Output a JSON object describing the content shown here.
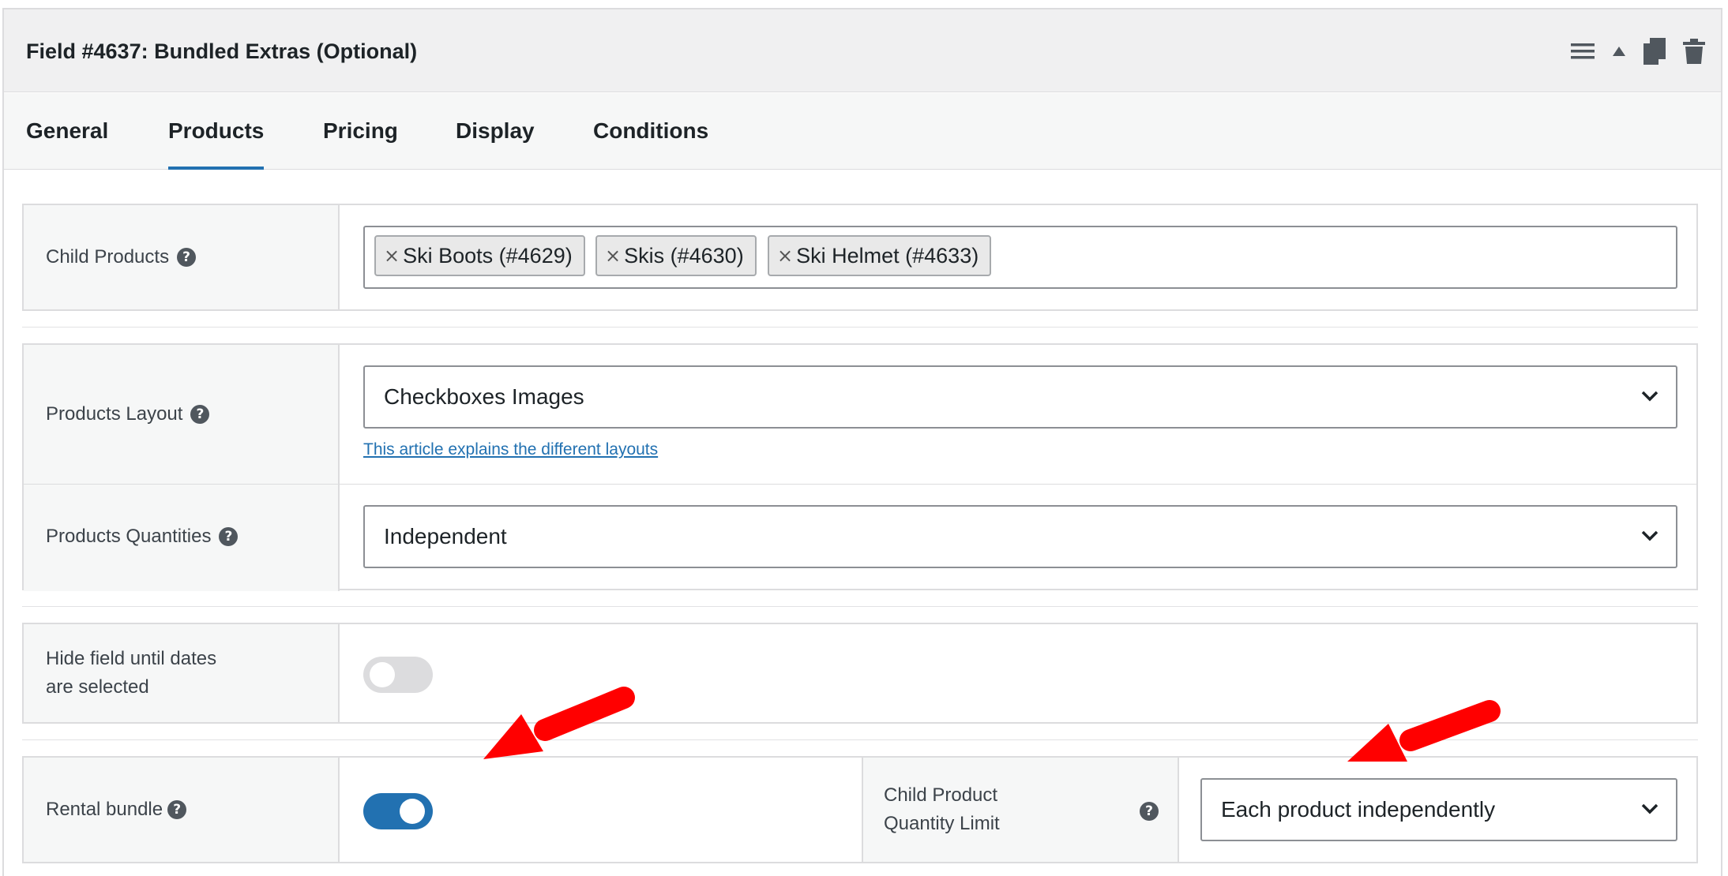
{
  "header": {
    "title": "Field #4637: Bundled Extras (Optional)",
    "icons": [
      "menu-icon",
      "collapse-arrow-icon",
      "duplicate-icon",
      "trash-icon"
    ]
  },
  "tabs": [
    {
      "label": "General",
      "active": false
    },
    {
      "label": "Products",
      "active": true
    },
    {
      "label": "Pricing",
      "active": false
    },
    {
      "label": "Display",
      "active": false
    },
    {
      "label": "Conditions",
      "active": false
    }
  ],
  "child_products": {
    "label": "Child Products",
    "tags": [
      "Ski Boots (#4629)",
      "Skis (#4630)",
      "Ski Helmet (#4633)"
    ],
    "remove_symbol": "×"
  },
  "products_layout": {
    "label": "Products Layout",
    "value": "Checkboxes Images",
    "link": "This article explains the different layouts"
  },
  "products_quantities": {
    "label": "Products Quantities",
    "value": "Independent"
  },
  "hide_field": {
    "label_line1": "Hide field until dates",
    "label_line2": "are selected",
    "enabled": false
  },
  "rental_bundle": {
    "label": "Rental bundle",
    "enabled": true
  },
  "child_quantity_limit": {
    "label_line1": "Child Product",
    "label_line2": "Quantity Limit",
    "value": "Each product independently"
  },
  "help_symbol": "?",
  "colors": {
    "accent": "#2271b1",
    "annotation_arrow": "#ff0000"
  }
}
